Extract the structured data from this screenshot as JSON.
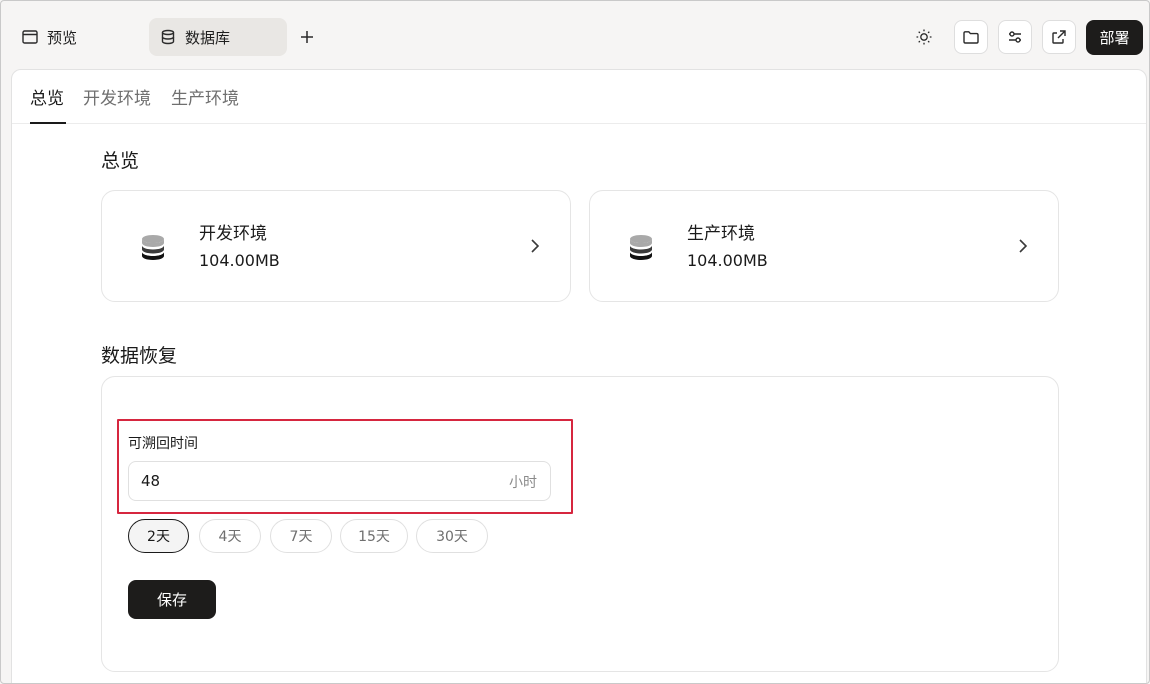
{
  "header": {
    "tabs": [
      {
        "label": "预览",
        "icon": "browser-window-icon",
        "active": false
      },
      {
        "label": "数据库",
        "icon": "database-icon",
        "active": true
      }
    ],
    "add_tab_icon": "plus-icon",
    "toolbar_icons": [
      "sun-icon",
      "folder-icon",
      "sliders-icon",
      "external-link-icon"
    ],
    "deploy_label": "部署"
  },
  "subtabs": [
    {
      "label": "总览",
      "active": true
    },
    {
      "label": "开发环境",
      "active": false
    },
    {
      "label": "生产环境",
      "active": false
    }
  ],
  "overview": {
    "title": "总览",
    "cards": [
      {
        "name": "开发环境",
        "size": "104.00MB",
        "icon": "database-stack-icon"
      },
      {
        "name": "生产环境",
        "size": "104.00MB",
        "icon": "database-stack-icon"
      }
    ]
  },
  "recovery": {
    "title": "数据恢复",
    "field_label": "可溯回时间",
    "field_value": "48",
    "field_unit": "小时",
    "presets": [
      {
        "label": "2天",
        "active": true
      },
      {
        "label": "4天",
        "active": false
      },
      {
        "label": "7天",
        "active": false
      },
      {
        "label": "15天",
        "active": false
      },
      {
        "label": "30天",
        "active": false
      }
    ],
    "save_label": "保存"
  },
  "colors": {
    "accent": "#1d1c1b",
    "highlight": "#d6263f",
    "background": "#f6f5f4"
  }
}
